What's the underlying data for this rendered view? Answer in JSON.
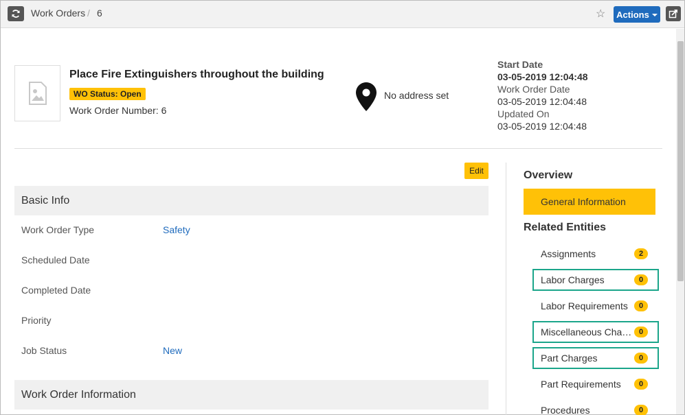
{
  "breadcrumb": {
    "root": "Work Orders",
    "separator": "/",
    "current": "6"
  },
  "toolbar": {
    "actions_label": "Actions"
  },
  "work_order": {
    "title": "Place Fire Extinguishers throughout the building",
    "status_badge": "WO Status: Open",
    "number_label": "Work Order Number:",
    "number_value": "6",
    "address": "No address set"
  },
  "dates": {
    "start_label": "Start Date",
    "start_value": "03-05-2019 12:04:48",
    "wo_date_label": "Work Order Date",
    "wo_date_value": "03-05-2019 12:04:48",
    "updated_label": "Updated On",
    "updated_value": "03-05-2019 12:04:48"
  },
  "edit_label": "Edit",
  "basic_info": {
    "heading": "Basic Info",
    "fields": [
      {
        "label": "Work Order Type",
        "value": "Safety"
      },
      {
        "label": "Scheduled Date",
        "value": ""
      },
      {
        "label": "Completed Date",
        "value": ""
      },
      {
        "label": "Priority",
        "value": ""
      },
      {
        "label": "Job Status",
        "value": "New"
      }
    ]
  },
  "wo_info": {
    "heading": "Work Order Information"
  },
  "sidebar": {
    "overview_heading": "Overview",
    "active_item": "General Information",
    "related_heading": "Related Entities",
    "items": [
      {
        "label": "Assignments",
        "count": "2"
      },
      {
        "label": "Labor Charges",
        "count": "0"
      },
      {
        "label": "Labor Requirements",
        "count": "0"
      },
      {
        "label": "Miscellaneous Charges",
        "count": "0"
      },
      {
        "label": "Part Charges",
        "count": "0"
      },
      {
        "label": "Part Requirements",
        "count": "0"
      },
      {
        "label": "Procedures",
        "count": "0"
      }
    ]
  },
  "colors": {
    "accent": "#ffc107",
    "link": "#1f6bbd",
    "highlight_border": "#1aa58a"
  }
}
